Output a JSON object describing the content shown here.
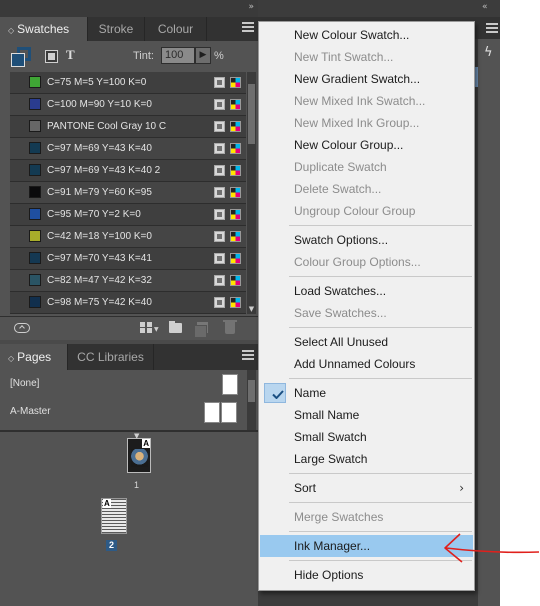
{
  "swatches_panel": {
    "tabs": [
      {
        "label": "Swatches",
        "active": true
      },
      {
        "label": "Stroke",
        "active": false
      },
      {
        "label": "Colour",
        "active": false
      }
    ],
    "tint_label": "Tint:",
    "tint_value": "100",
    "tint_unit": "%",
    "swatches": [
      {
        "name": "C=75 M=5 Y=100 K=0",
        "color": "#3fa535"
      },
      {
        "name": "C=100 M=90 Y=10 K=0",
        "color": "#2a3c8f"
      },
      {
        "name": "PANTONE Cool Gray 10 C",
        "color": "#676767"
      },
      {
        "name": "C=97 M=69 Y=43 K=40",
        "color": "#133a52"
      },
      {
        "name": "C=97 M=69 Y=43 K=40 2",
        "color": "#133a52"
      },
      {
        "name": "C=91 M=79 Y=60 K=95",
        "color": "#0a0a0c"
      },
      {
        "name": "C=95 M=70 Y=2 K=0",
        "color": "#1f4fa0"
      },
      {
        "name": "C=42 M=18 Y=100 K=0",
        "color": "#a8ad2a"
      },
      {
        "name": "C=97 M=70 Y=43 K=41",
        "color": "#143852"
      },
      {
        "name": "C=82 M=47 Y=42 K=32",
        "color": "#2a5464"
      },
      {
        "name": "C=98 M=75 Y=42 K=40",
        "color": "#112f4d"
      }
    ]
  },
  "pages_panel": {
    "tabs": [
      {
        "label": "Pages",
        "active": true
      },
      {
        "label": "CC Libraries",
        "active": false
      }
    ],
    "masters": [
      {
        "label": "[None]"
      },
      {
        "label": "A-Master"
      }
    ],
    "pages": [
      {
        "number": "1",
        "master_letter": "A"
      },
      {
        "number": "2",
        "master_letter": "A"
      }
    ]
  },
  "context_menu": {
    "items": [
      {
        "label": "New Colour Swatch...",
        "enabled": true
      },
      {
        "label": "New Tint Swatch...",
        "enabled": false
      },
      {
        "label": "New Gradient Swatch...",
        "enabled": true
      },
      {
        "label": "New Mixed Ink Swatch...",
        "enabled": false
      },
      {
        "label": "New Mixed Ink Group...",
        "enabled": false
      },
      {
        "label": "New Colour Group...",
        "enabled": true
      },
      {
        "label": "Duplicate Swatch",
        "enabled": false
      },
      {
        "label": "Delete Swatch...",
        "enabled": false
      },
      {
        "label": "Ungroup Colour Group",
        "enabled": false
      },
      {
        "label": "Swatch Options...",
        "enabled": true
      },
      {
        "label": "Colour Group Options...",
        "enabled": false
      },
      {
        "label": "Load Swatches...",
        "enabled": true
      },
      {
        "label": "Save Swatches...",
        "enabled": false
      },
      {
        "label": "Select All Unused",
        "enabled": true
      },
      {
        "label": "Add Unnamed Colours",
        "enabled": true
      },
      {
        "label": "Name",
        "enabled": true,
        "checked": true
      },
      {
        "label": "Small Name",
        "enabled": true
      },
      {
        "label": "Small Swatch",
        "enabled": true
      },
      {
        "label": "Large Swatch",
        "enabled": true
      },
      {
        "label": "Sort",
        "enabled": true,
        "submenu": true
      },
      {
        "label": "Merge Swatches",
        "enabled": false
      },
      {
        "label": "Ink Manager...",
        "enabled": true,
        "highlighted": true
      },
      {
        "label": "Hide Options",
        "enabled": true
      }
    ]
  },
  "colors": {
    "panel_bg": "#535353",
    "menu_highlight": "#99c9ef",
    "annotation": "#e0201c"
  }
}
